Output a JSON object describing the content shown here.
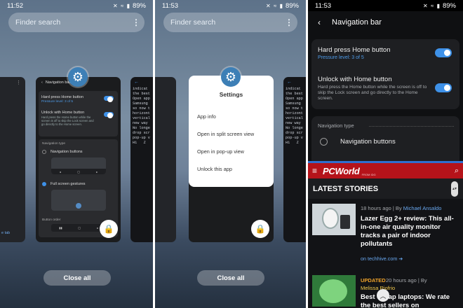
{
  "status_bar": {
    "left_time": "11:52",
    "mid_time": "11:53",
    "right_time": "11:53",
    "battery": "89%",
    "icons_text": "✕ ≈ ▮"
  },
  "search": {
    "placeholder": "Finder search"
  },
  "close_all_label": "Close all",
  "settings_card": {
    "header_title": "Navigation bar",
    "hard_press_label": "Hard press Home button",
    "pressure_level": "Pressure level: 3 of 5",
    "unlock_label": "Unlock with Home button",
    "unlock_desc": "Hard press the Home button while the screen is off to skip the Lock screen and go directly to the Home screen.",
    "nav_type_label": "Navigation type",
    "nav_buttons_label": "Navigation buttons",
    "full_screen_label": "Full screen gestures",
    "button_order_label": "Button order"
  },
  "terminal_card": {
    "lines": [
      "indicat",
      "the best",
      "",
      "Open app",
      "Samsung",
      "so now t",
      "horizont",
      "vertical",
      "new way",
      "No longe",
      "drop scr",
      "pop-up v",
      "H1   Z"
    ]
  },
  "left_card_tab": "e tab",
  "context_menu": {
    "title": "Settings",
    "items": [
      "App info",
      "Open in split screen view",
      "Open in pop-up view",
      "Unlock this app"
    ]
  },
  "pcworld": {
    "logo": "PCWorld",
    "logo_sub": "FROM IDG",
    "section": "LATEST STORIES",
    "article1": {
      "meta_prefix": "18 hours ago | By ",
      "author": "Michael Ansaldo",
      "title": "Lazer Egg 2+ review: This all-in-one air quality monitor tracks a pair of indoor pollutants",
      "source": "on techhive.com ➔"
    },
    "article2": {
      "tag": "UPDATED",
      "meta": "20 hours ago | By",
      "author": "Melissa Riofrio",
      "title": "Best cheap laptops: We rate the best sellers on"
    }
  },
  "colors": {
    "accent_blue": "#3e91e8",
    "pcworld_red": "#b5131a",
    "orange_tag": "#f0a32a",
    "link_yellow": "#f2c94c",
    "link_blue": "#69a8f0"
  }
}
